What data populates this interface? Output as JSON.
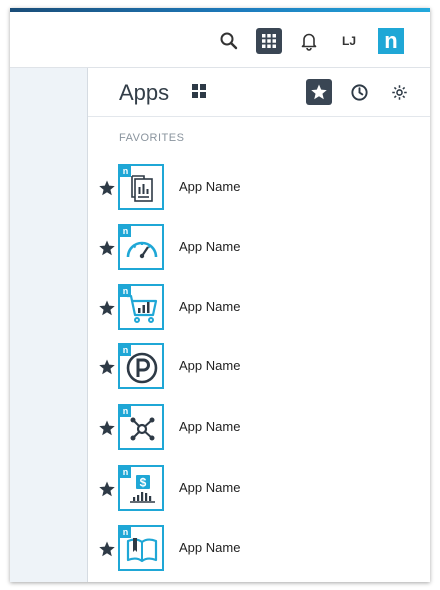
{
  "topbar": {
    "icons": [
      "search-icon",
      "apps-grid-icon",
      "bell-icon",
      "user-initials",
      "brand-logo"
    ],
    "user_initials": "LJ",
    "brand_logo_text": "n"
  },
  "panel": {
    "title": "Apps",
    "section_label": "FAVORITES",
    "header_icons": [
      "grid-view-icon",
      "favorites-star-icon",
      "recent-clock-icon",
      "settings-gear-icon"
    ]
  },
  "apps": [
    {
      "name": "App Name",
      "icon": "documents-chart-icon"
    },
    {
      "name": "App Name",
      "icon": "speedometer-icon"
    },
    {
      "name": "App Name",
      "icon": "shopping-cart-chart-icon"
    },
    {
      "name": "App Name",
      "icon": "letter-p-circle-icon"
    },
    {
      "name": "App Name",
      "icon": "network-nodes-icon"
    },
    {
      "name": "App Name",
      "icon": "dollar-chart-icon"
    },
    {
      "name": "App Name",
      "icon": "open-book-icon"
    }
  ],
  "tile_badge": "n",
  "colors": {
    "accent": "#1fa7d6",
    "dark": "#3a4654",
    "stripe": "#1d7bbd"
  }
}
